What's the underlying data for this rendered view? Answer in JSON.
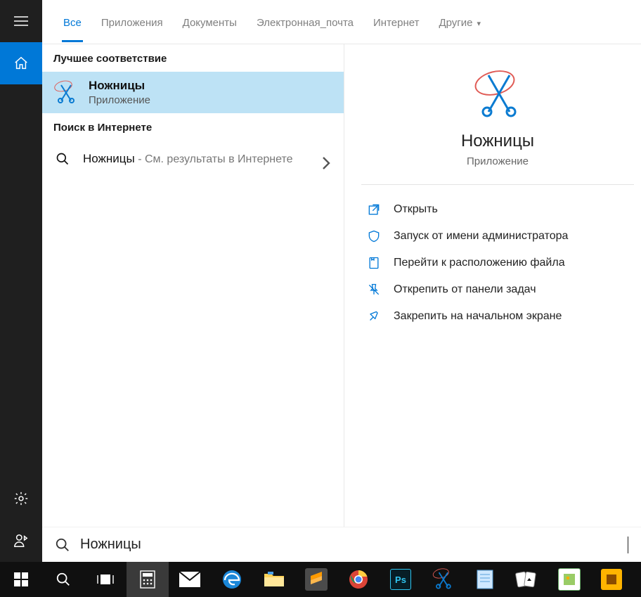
{
  "tabs": {
    "all": "Все",
    "apps": "Приложения",
    "docs": "Документы",
    "mail": "Электронная_почта",
    "web": "Интернет",
    "more": "Другие"
  },
  "groups": {
    "best": "Лучшее соответствие",
    "web": "Поиск в Интернете"
  },
  "result": {
    "title": "Ножницы",
    "subtitle": "Приложение"
  },
  "webresult": {
    "query": "Ножницы",
    "suffix": " - См. результаты в Интернете"
  },
  "preview": {
    "title": "Ножницы",
    "subtitle": "Приложение",
    "actions": {
      "open": "Открыть",
      "admin": "Запуск от имени администратора",
      "loc": "Перейти к расположению файла",
      "unpin_tb": "Открепить от панели задач",
      "pin_start": "Закрепить на начальном экране"
    }
  },
  "search": {
    "value": "Ножницы"
  }
}
